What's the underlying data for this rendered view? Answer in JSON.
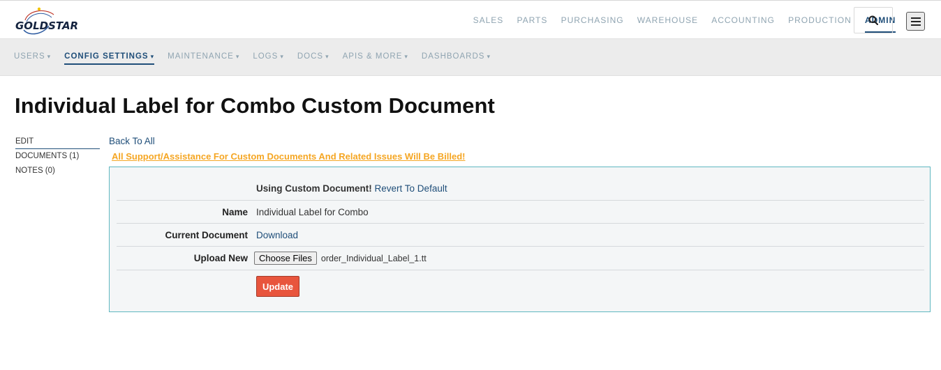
{
  "brand": {
    "name": "GOLDSTAR"
  },
  "topnav": {
    "items": [
      {
        "label": "SALES"
      },
      {
        "label": "PARTS"
      },
      {
        "label": "PURCHASING"
      },
      {
        "label": "WAREHOUSE"
      },
      {
        "label": "ACCOUNTING"
      },
      {
        "label": "PRODUCTION"
      },
      {
        "label": "ADMIN"
      }
    ],
    "active": "ADMIN"
  },
  "icons": {
    "search": "search-icon",
    "menu": "hamburger-menu-icon"
  },
  "subnav": {
    "items": [
      {
        "label": "USERS"
      },
      {
        "label": "CONFIG SETTINGS"
      },
      {
        "label": "MAINTENANCE"
      },
      {
        "label": "LOGS"
      },
      {
        "label": "DOCS"
      },
      {
        "label": "APIS & MORE"
      },
      {
        "label": "DASHBOARDS"
      }
    ],
    "caret": "▾",
    "active": "CONFIG SETTINGS"
  },
  "page": {
    "title": "Individual Label for Combo Custom Document"
  },
  "side_menu": {
    "items": [
      {
        "label": "EDIT"
      },
      {
        "label": "DOCUMENTS (1)"
      },
      {
        "label": "NOTES (0)"
      }
    ]
  },
  "back_link": "Back To All",
  "warning": "All Support/Assistance For Custom Documents And Related Issues Will Be Billed!",
  "form": {
    "status_label": "Using Custom Document!",
    "revert_link": "Revert To Default",
    "name_label": "Name",
    "name_value": "Individual Label for Combo",
    "current_doc_label": "Current Document",
    "download_link": "Download",
    "upload_label": "Upload New",
    "choose_button": "Choose Files",
    "file_name": "order_Individual_Label_1.tt",
    "update_button": "Update"
  },
  "colors": {
    "accent": "#1f4e79",
    "warning": "#f5a623",
    "update_button": "#e8553d",
    "panel_border": "#5fb7c0"
  }
}
